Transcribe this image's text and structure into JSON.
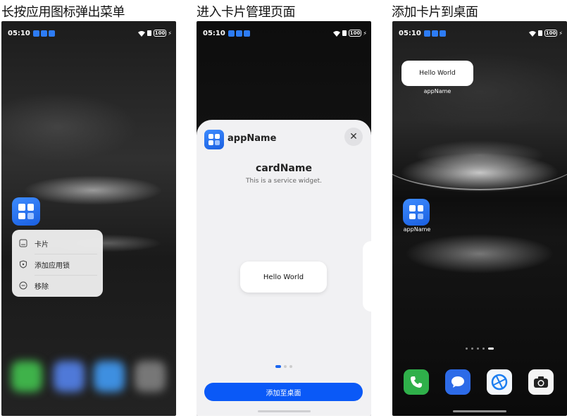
{
  "panels": [
    {
      "title": "长按应用图标弹出菜单"
    },
    {
      "title": "进入卡片管理页面"
    },
    {
      "title": "添加卡片到桌面"
    }
  ],
  "status_bar": {
    "time": "05:10",
    "battery": "100"
  },
  "context_menu": {
    "items": [
      {
        "label": "卡片",
        "icon": "card-icon"
      },
      {
        "label": "添加应用锁",
        "icon": "shield-lock-icon"
      },
      {
        "label": "移除",
        "icon": "remove-circle-icon"
      }
    ]
  },
  "widget_sheet": {
    "app_name": "appName",
    "card_name": "cardName",
    "card_description": "This is a service widget.",
    "preview_text": "Hello World",
    "add_button_label": "添加至桌面",
    "pages": 3,
    "current_page": 1
  },
  "home": {
    "widget_text": "Hello World",
    "widget_label": "appName",
    "app_label": "appName",
    "pages": 5,
    "current_page": 5,
    "dock": [
      "phone-app-icon",
      "messages-app-icon",
      "browser-app-icon",
      "camera-app-icon"
    ]
  },
  "colors": {
    "accent": "#0a59f7",
    "app_icon": "#2d7cf6"
  }
}
